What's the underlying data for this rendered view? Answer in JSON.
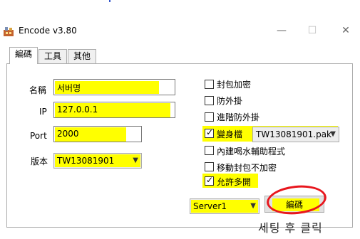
{
  "window": {
    "title": "Encode v3.80",
    "minimize_glyph": "—",
    "maximize_glyph": "☐",
    "close_glyph": "✕"
  },
  "tabs": [
    {
      "label": "編碼",
      "active": true
    },
    {
      "label": "工具",
      "active": false
    },
    {
      "label": "其他",
      "active": false
    }
  ],
  "form": {
    "name": {
      "label": "名稱",
      "value": "서버명"
    },
    "ip": {
      "label": "IP",
      "value": "127.0.0.1"
    },
    "port": {
      "label": "Port",
      "value": "2000"
    },
    "version": {
      "label": "版本",
      "value": "TW13081901"
    }
  },
  "options": [
    {
      "label": "封包加密",
      "checked": false
    },
    {
      "label": "防外掛",
      "checked": false
    },
    {
      "label": "進階防外掛",
      "checked": false
    },
    {
      "label": "變身檔",
      "checked": true
    },
    {
      "label": "內建喝水輔助程式",
      "checked": false
    },
    {
      "label": "移動封包不加密",
      "checked": false
    },
    {
      "label": "允許多開",
      "checked": true
    }
  ],
  "transform_file": {
    "value": "TW13081901.pak"
  },
  "server_select": {
    "value": "Server1"
  },
  "encode_button": {
    "label": "編碼"
  },
  "annotation": {
    "text": "세팅 후 클릭",
    "circle_color": "#e8161d",
    "highlight_color": "#ffff00"
  },
  "icons": {
    "app": "app-icon",
    "dropdown": "chevron-down-icon",
    "checkmark": "checkmark-icon"
  }
}
